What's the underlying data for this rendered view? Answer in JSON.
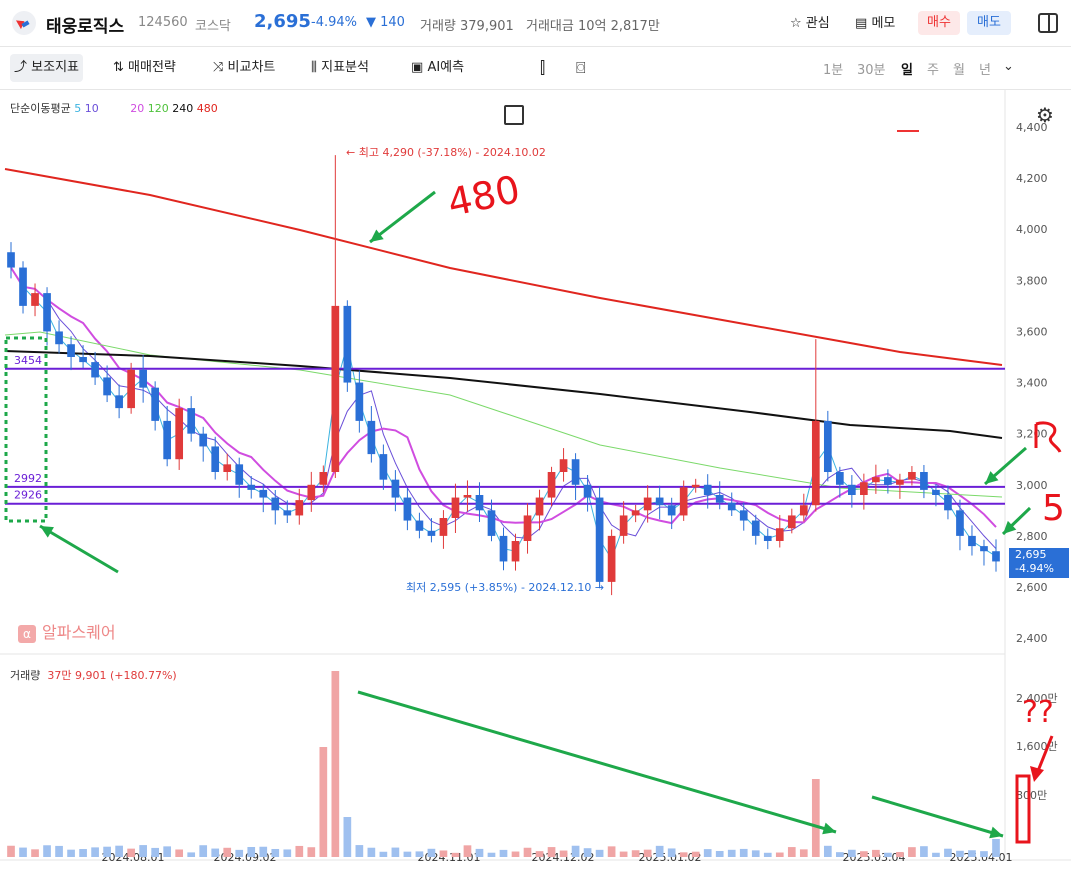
{
  "header": {
    "stock_name": "태웅로직스",
    "stock_code": "124560",
    "market": "코스닥",
    "price": "2,695",
    "change_pct": "-4.94%",
    "change_val": "▼ 140",
    "volume_label": "거래량 379,901",
    "amount_label": "거래대금 10억 2,817만",
    "watch_label": "관심",
    "memo_label": "메모",
    "buy_label": "매수",
    "sell_label": "매도"
  },
  "toolbar": {
    "indicator_label": "보조지표",
    "strategy_label": "매매전략",
    "compare_label": "비교차트",
    "analysis_label": "지표분석",
    "ai_label": "AI예측",
    "periods": [
      "1분",
      "30분",
      "일",
      "주",
      "월",
      "년"
    ],
    "selected_period": "일"
  },
  "legend": {
    "ma_title": "단순이동평균",
    "ma_5": "5",
    "ma_10": "10",
    "ma_20": "20",
    "ma_120": "120",
    "ma_240": "240",
    "ma_480": "480",
    "volume_title": "거래량",
    "volume_value": "37만 9,901 (+180.77%)"
  },
  "colors": {
    "up": "#e03a3a",
    "down": "#2a6fd6",
    "ma5": "#3bb3e0",
    "ma10": "#6a4fd9",
    "ma20": "#d04de0",
    "ma120": "#7bd96a",
    "ma240": "#111111",
    "ma480": "#e0261f",
    "hline": "#6a1fd6",
    "annot_green": "#1ea84a",
    "annot_red": "#e8141c"
  },
  "chart_data": {
    "type": "candlestick",
    "price_axis_ticks": [
      "4,400",
      "4,200",
      "4,000",
      "3,800",
      "3,600",
      "3,400",
      "3,200",
      "3,000",
      "2,800",
      "2,600",
      "2,400"
    ],
    "volume_axis_ticks": [
      "2,400만",
      "1,600만",
      "800만"
    ],
    "date_ticks": [
      "2024.08.01",
      "2024.09.02",
      "2024.11.01",
      "2024.12.02",
      "2025.01.02",
      "2025.03.04",
      "2025.04.01"
    ],
    "high_annotation": "최고 4,290 (-37.18%) - 2024.10.02",
    "low_annotation": "최저 2,595 (+3.85%) - 2024.12.10",
    "horizontal_lines": [
      {
        "label": "3454",
        "value": 3454
      },
      {
        "label": "2992",
        "value": 2992
      },
      {
        "label": "2926",
        "value": 2926
      }
    ],
    "current_price": "2,695",
    "current_change": "-4.94%",
    "price_path": [
      3850,
      3700,
      3750,
      3600,
      3550,
      3500,
      3480,
      3420,
      3350,
      3300,
      3450,
      3380,
      3250,
      3100,
      3300,
      3200,
      3150,
      3050,
      3080,
      3000,
      2980,
      2950,
      2900,
      2880,
      2940,
      3000,
      3050,
      3700,
      3400,
      3250,
      3120,
      3020,
      2950,
      2860,
      2820,
      2800,
      2870,
      2950,
      2960,
      2900,
      2800,
      2700,
      2780,
      2880,
      2950,
      3050,
      3100,
      3000,
      2950,
      2620,
      2800,
      2880,
      2900,
      2950,
      2920,
      2880,
      2990,
      3000,
      2960,
      2930,
      2900,
      2860,
      2800,
      2780,
      2830,
      2880,
      2920,
      3250,
      3050,
      3000,
      2960,
      3010,
      3030,
      3000,
      3020,
      3050,
      2980,
      2960,
      2900,
      2800,
      2760,
      2740,
      2700
    ]
  },
  "annotations": {
    "label_480": "480",
    "label_5": "5",
    "label_question": "??"
  },
  "watermark": "알파스퀘어",
  "watermark_badge": "α"
}
